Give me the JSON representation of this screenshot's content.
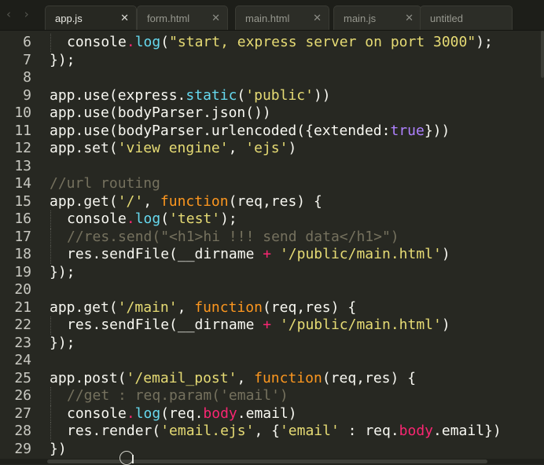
{
  "tabs": [
    {
      "label": "app.js",
      "active": true
    },
    {
      "label": "form.html",
      "active": false
    },
    {
      "label": "main.html",
      "active": false
    },
    {
      "label": "main.js",
      "active": false
    },
    {
      "label": "untitled",
      "active": false
    }
  ],
  "tab_close_glyph": "✕",
  "nav_glyph": "‹ ›",
  "colors": {
    "background": "#272822",
    "plain": "#f8f8f2",
    "keyword_pink": "#f92672",
    "function_cyan": "#66d9ef",
    "string_yellow": "#e6db74",
    "keyword_orange": "#fd971f",
    "comment_gray": "#75715e",
    "constant_purple": "#ae81ff"
  },
  "lines": [
    {
      "num": "6",
      "indent": 1,
      "tokens": [
        [
          "p",
          "console"
        ],
        [
          "m",
          "."
        ],
        [
          "f",
          "log"
        ],
        [
          "p",
          "("
        ],
        [
          "s",
          "\"start, express server on port 3000\""
        ],
        [
          "p",
          ");"
        ]
      ]
    },
    {
      "num": "7",
      "indent": 0,
      "tokens": [
        [
          "p",
          "});"
        ]
      ]
    },
    {
      "num": "8",
      "indent": 0,
      "tokens": []
    },
    {
      "num": "9",
      "indent": 0,
      "tokens": [
        [
          "p",
          "app.use(express."
        ],
        [
          "f",
          "static"
        ],
        [
          "p",
          "("
        ],
        [
          "s",
          "'public'"
        ],
        [
          "p",
          "))"
        ]
      ]
    },
    {
      "num": "10",
      "indent": 0,
      "tokens": [
        [
          "p",
          "app.use(bodyParser.json())"
        ]
      ]
    },
    {
      "num": "11",
      "indent": 0,
      "tokens": [
        [
          "p",
          "app.use(bodyParser.urlencoded({extended:"
        ],
        [
          "n",
          "true"
        ],
        [
          "p",
          "}))"
        ]
      ]
    },
    {
      "num": "12",
      "indent": 0,
      "tokens": [
        [
          "p",
          "app.set("
        ],
        [
          "s",
          "'view engine'"
        ],
        [
          "p",
          ", "
        ],
        [
          "s",
          "'ejs'"
        ],
        [
          "p",
          ")"
        ]
      ]
    },
    {
      "num": "13",
      "indent": 0,
      "tokens": []
    },
    {
      "num": "14",
      "indent": 0,
      "tokens": [
        [
          "c",
          "//url routing"
        ]
      ]
    },
    {
      "num": "15",
      "indent": 0,
      "tokens": [
        [
          "p",
          "app.get("
        ],
        [
          "s",
          "'/'"
        ],
        [
          "p",
          ", "
        ],
        [
          "k",
          "function"
        ],
        [
          "p",
          "(req,res) {"
        ]
      ]
    },
    {
      "num": "16",
      "indent": 1,
      "tokens": [
        [
          "p",
          "console"
        ],
        [
          "m",
          "."
        ],
        [
          "f",
          "log"
        ],
        [
          "p",
          "("
        ],
        [
          "s",
          "'test'"
        ],
        [
          "p",
          ");"
        ]
      ]
    },
    {
      "num": "17",
      "indent": 1,
      "tokens": [
        [
          "c",
          "//res.send(\"<h1>hi !!! send data</h1>\")"
        ]
      ]
    },
    {
      "num": "18",
      "indent": 1,
      "tokens": [
        [
          "p",
          "res.sendFile(__dirname "
        ],
        [
          "m",
          "+"
        ],
        [
          "p",
          " "
        ],
        [
          "s",
          "'/public/main.html'"
        ],
        [
          "p",
          ")"
        ]
      ]
    },
    {
      "num": "19",
      "indent": 0,
      "tokens": [
        [
          "p",
          "});"
        ]
      ]
    },
    {
      "num": "20",
      "indent": 0,
      "tokens": []
    },
    {
      "num": "21",
      "indent": 0,
      "tokens": [
        [
          "p",
          "app.get("
        ],
        [
          "s",
          "'/main'"
        ],
        [
          "p",
          ", "
        ],
        [
          "k",
          "function"
        ],
        [
          "p",
          "(req,res) {"
        ]
      ]
    },
    {
      "num": "22",
      "indent": 1,
      "tokens": [
        [
          "p",
          "res.sendFile(__dirname "
        ],
        [
          "m",
          "+"
        ],
        [
          "p",
          " "
        ],
        [
          "s",
          "'/public/main.html'"
        ],
        [
          "p",
          ")"
        ]
      ]
    },
    {
      "num": "23",
      "indent": 0,
      "tokens": [
        [
          "p",
          "});"
        ]
      ]
    },
    {
      "num": "24",
      "indent": 0,
      "tokens": []
    },
    {
      "num": "25",
      "indent": 0,
      "tokens": [
        [
          "p",
          "app.post("
        ],
        [
          "s",
          "'/email_post'"
        ],
        [
          "p",
          ", "
        ],
        [
          "k",
          "function"
        ],
        [
          "p",
          "(req,res) {"
        ]
      ]
    },
    {
      "num": "26",
      "indent": 1,
      "tokens": [
        [
          "c",
          "//get : req.param('email')"
        ]
      ]
    },
    {
      "num": "27",
      "indent": 1,
      "tokens": [
        [
          "p",
          "console"
        ],
        [
          "m",
          "."
        ],
        [
          "f",
          "log"
        ],
        [
          "p",
          "(req."
        ],
        [
          "m",
          "body"
        ],
        [
          "p",
          ".email)"
        ]
      ]
    },
    {
      "num": "28",
      "indent": 1,
      "tokens": [
        [
          "p",
          "res.render("
        ],
        [
          "s",
          "'email.ejs'"
        ],
        [
          "p",
          ", {"
        ],
        [
          "s",
          "'email'"
        ],
        [
          "p",
          " : req."
        ],
        [
          "m",
          "body"
        ],
        [
          "p",
          ".email})"
        ]
      ]
    },
    {
      "num": "29",
      "indent": 0,
      "tokens": [
        [
          "p",
          "})"
        ]
      ]
    }
  ]
}
